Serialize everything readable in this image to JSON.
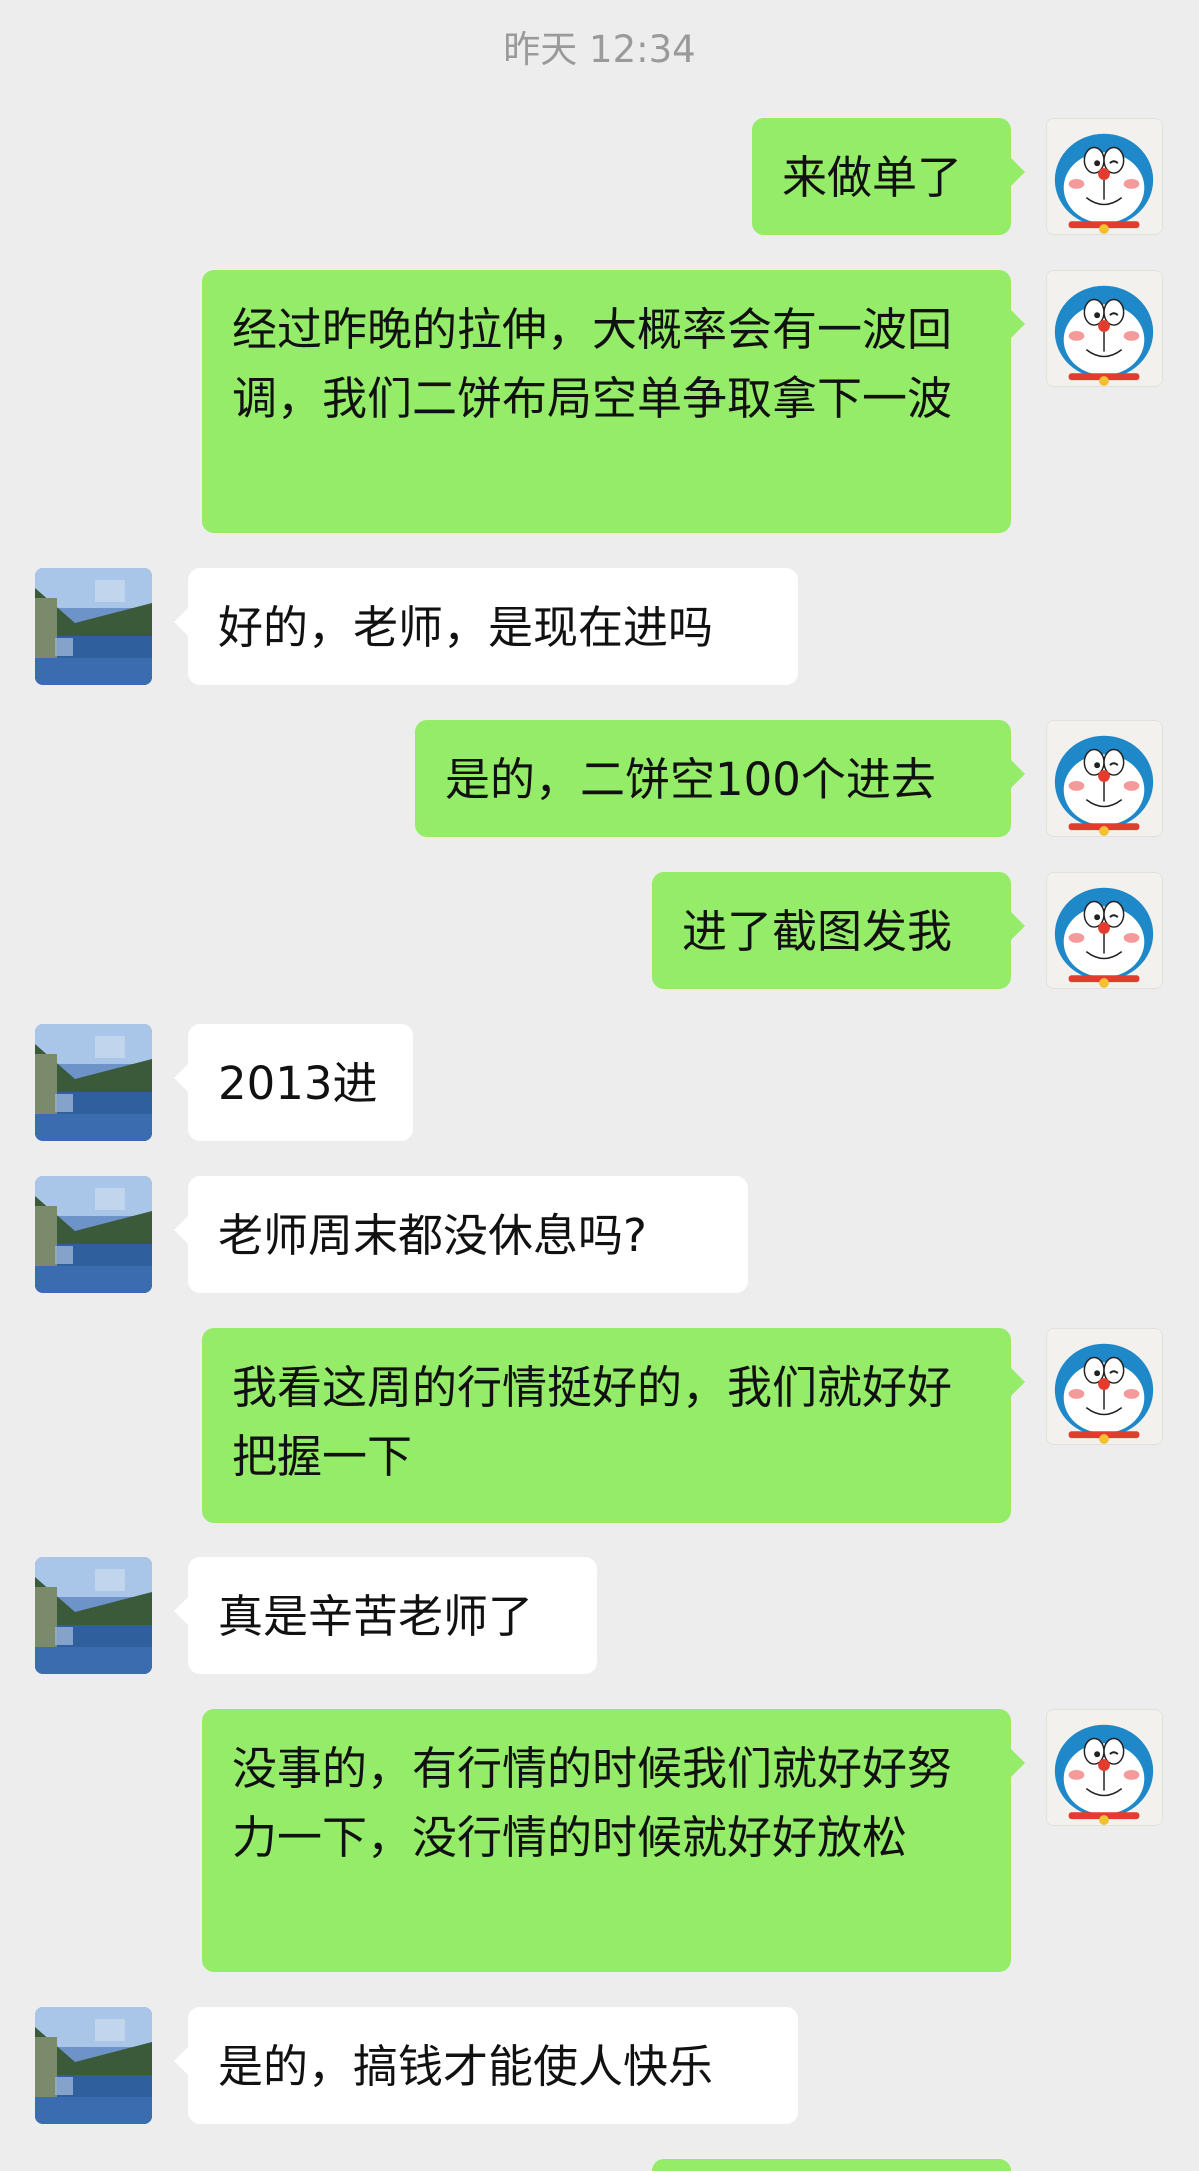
{
  "chat": {
    "timestamp": "昨天 12:34",
    "messages": [
      {
        "sender": "self",
        "text": "来做单了"
      },
      {
        "sender": "self",
        "text": "经过昨晚的拉伸，大概率会有一波回调，我们二饼布局空单争取拿下一波"
      },
      {
        "sender": "peer",
        "text": "好的，老师，是现在进吗"
      },
      {
        "sender": "self",
        "text": "是的，二饼空100个进去"
      },
      {
        "sender": "self",
        "text": "进了截图发我"
      },
      {
        "sender": "peer",
        "text": "2013进"
      },
      {
        "sender": "peer",
        "text": "老师周末都没休息吗?"
      },
      {
        "sender": "self",
        "text": "我看这周的行情挺好的，我们就好好把握一下"
      },
      {
        "sender": "peer",
        "text": "真是辛苦老师了"
      },
      {
        "sender": "self",
        "text": "没事的，有行情的时候我们就好好努力一下，没行情的时候就好好放松"
      },
      {
        "sender": "peer",
        "text": "是的，搞钱才能使人快乐"
      },
      {
        "sender": "self",
        "text": ""
      }
    ]
  },
  "avatars": {
    "self_icon": "doraemon-avatar-icon",
    "peer_icon": "lake-landscape-avatar-icon"
  },
  "colors": {
    "background": "#ededed",
    "self_bubble": "#95ec69",
    "peer_bubble": "#ffffff",
    "timestamp_text": "#9a9a9a",
    "doraemon_blue": "#1e88c8",
    "doraemon_red": "#e33b2e"
  }
}
